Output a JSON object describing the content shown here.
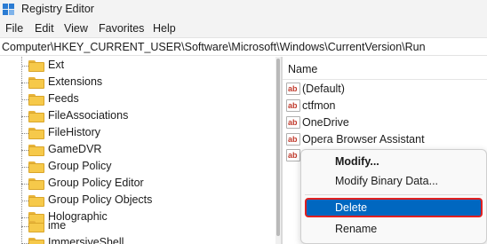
{
  "window": {
    "title": "Registry Editor"
  },
  "menu": [
    "File",
    "Edit",
    "View",
    "Favorites",
    "Help"
  ],
  "address": {
    "path": "Computer\\HKEY_CURRENT_USER\\Software\\Microsoft\\Windows\\CurrentVersion\\Run"
  },
  "tree": {
    "items": [
      {
        "label": "Ext"
      },
      {
        "label": "Extensions"
      },
      {
        "label": "Feeds"
      },
      {
        "label": "FileAssociations"
      },
      {
        "label": "FileHistory"
      },
      {
        "label": "GameDVR"
      },
      {
        "label": "Group Policy"
      },
      {
        "label": "Group Policy Editor"
      },
      {
        "label": "Group Policy Objects"
      },
      {
        "label": "Holographic"
      },
      {
        "label": "ime"
      },
      {
        "label": "ImmersiveShell"
      }
    ]
  },
  "values_list": {
    "column_name": "Name",
    "rows": [
      {
        "icon": "ab-string-icon",
        "name": "(Default)"
      },
      {
        "icon": "ab-string-icon",
        "name": "ctfmon"
      },
      {
        "icon": "ab-string-icon",
        "name": "OneDrive"
      },
      {
        "icon": "ab-string-icon",
        "name": "Opera Browser Assistant"
      },
      {
        "icon": "ab-string-icon",
        "name": ""
      }
    ]
  },
  "context_menu": {
    "modify": "Modify...",
    "modify_binary": "Modify Binary Data...",
    "delete": "Delete",
    "rename": "Rename"
  },
  "colors": {
    "selection": "#0067c0",
    "highlight_border": "#e02020",
    "folder": "#f6c94a",
    "app_icon": "#2b7cd3"
  }
}
